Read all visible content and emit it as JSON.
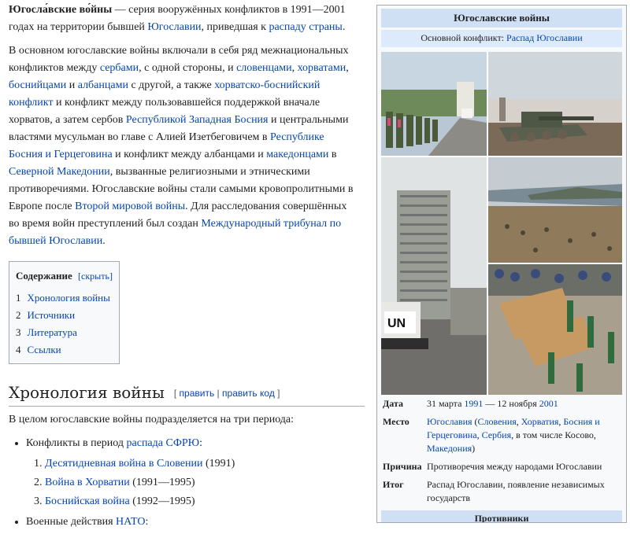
{
  "article": {
    "lead": {
      "title_bold": "Югосла́вские во́йны",
      "t1": " — серия вооружённых конфликтов в 1991—2001 годах на территории бывшей ",
      "link_yugoslavia": "Югославии",
      "t2": ", приведшая к ",
      "link_breakup": "распаду страны",
      "t3": "."
    },
    "para2": {
      "t1": "В основном югославские войны включали в себя ряд межнациональных конфликтов между ",
      "link_serbs": "сербами",
      "t2": ", с одной стороны, и ",
      "link_slovenes": "словенцами",
      "t3": ", ",
      "link_croats": "хорватами",
      "t4": ", ",
      "link_bosniaks": "боснийцами",
      "t5": " и ",
      "link_albanians": "албанцами",
      "t6": " с другой, а также ",
      "link_croat_bosniak": "хорватско-боснийский конфликт",
      "t7": " и конфликт между пользовавшейся поддержкой вначале хорватов, а затем сербов ",
      "link_wbosnia": "Республикой Западная Босния",
      "t8": " и центральными властями мусульман во главе с Алией Изетбеговичем в ",
      "link_rbih": "Республике Босния и Герцеговина",
      "t9": " и конфликт между албанцами и ",
      "link_macedonians": "македонцами",
      "t10": " в ",
      "link_nmacedonia": "Северной Македонии",
      "t11": ", вызванные религиозными и этническими противоречиями. Югославские войны стали самыми кровопролитными в Европе после ",
      "link_ww2": "Второй мировой войны",
      "t12": ". Для расследования совершённых во время войн преступлений был создан ",
      "link_icty": "Международный трибунал по бывшей Югославии",
      "t13": "."
    },
    "toc": {
      "title": "Содержание",
      "toggle": "[скрыть]",
      "items": [
        {
          "num": "1",
          "label": "Хронология войны"
        },
        {
          "num": "2",
          "label": "Источники"
        },
        {
          "num": "3",
          "label": "Литература"
        },
        {
          "num": "4",
          "label": "Ссылки"
        }
      ]
    },
    "section1": {
      "heading": "Хронология войны",
      "edit_open": "[ ",
      "edit": "править",
      "sep": " | ",
      "edit_code": "править код",
      "edit_close": " ]",
      "intro": "В целом югославские войны подразделяется на три периода:",
      "b1_text": "Конфликты в период ",
      "b1_link": "распада СФРЮ",
      "b1_colon": ":",
      "periods": [
        {
          "link": "Десятидневная война в Словении",
          "years": " (1991)"
        },
        {
          "link": "Война в Хорватии",
          "years": " (1991—1995)"
        },
        {
          "link": "Боснийская война",
          "years": " (1992—1995)"
        }
      ],
      "b2_text": "Военные действия ",
      "b2_link": "НАТО",
      "b2_colon": ":"
    }
  },
  "infobox": {
    "title": "Югославские войны",
    "sub_label": "Основной конфликт: ",
    "sub_link": "Распад Югославии",
    "collage_sign": "UN",
    "rows": {
      "date_label": "Дата",
      "date_t1": "31 марта ",
      "date_l1": "1991",
      "date_t2": " — 12 ноября ",
      "date_l2": "2001",
      "place_label": "Место",
      "place_l1": "Югославия",
      "place_t1": " (",
      "place_l2": "Словения",
      "place_t2": ", ",
      "place_l3": "Хорватия",
      "place_t3": ", ",
      "place_l4": "Босния и Герцеговина",
      "place_t4": ", ",
      "place_l5": "Сербия",
      "place_t5": ", в том числе Косово, ",
      "place_l6": "Македония",
      "place_t6": ")",
      "cause_label": "Причина",
      "cause_value": "Противоречия между народами Югославии",
      "result_label": "Итог",
      "result_value": "Распад Югославии, появление независимых государств"
    },
    "section_label": "Противники"
  }
}
